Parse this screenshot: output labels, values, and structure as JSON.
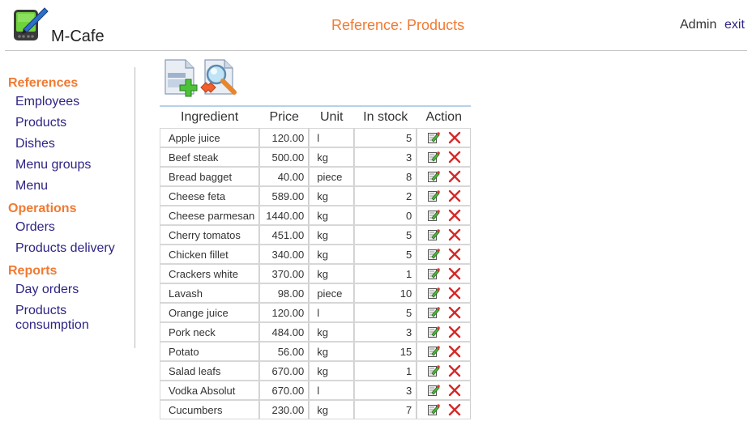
{
  "header": {
    "app_name": "M-Cafe",
    "page_title": "Reference: Products",
    "user_name": "Admin",
    "exit_label": "exit",
    "logo_icon": "pda-stylus-icon"
  },
  "colors": {
    "accent_orange": "#f07a32",
    "link_navy": "#2e2485",
    "delete_red": "#d42a2a"
  },
  "sidebar": {
    "sections": [
      {
        "title": "References",
        "items": [
          {
            "label": "Employees"
          },
          {
            "label": "Products"
          },
          {
            "label": "Dishes"
          },
          {
            "label": "Menu groups"
          },
          {
            "label": "Menu"
          }
        ]
      },
      {
        "title": "Operations",
        "items": [
          {
            "label": "Orders"
          },
          {
            "label": "Products delivery"
          }
        ]
      },
      {
        "title": "Reports",
        "items": [
          {
            "label": "Day orders"
          },
          {
            "label": "Products consumption"
          }
        ]
      }
    ]
  },
  "toolbar": {
    "add_icon": "add-document-icon",
    "search_icon": "find-document-icon"
  },
  "table": {
    "columns": [
      "Ingredient",
      "Price",
      "Unit",
      "In stock",
      "Action"
    ],
    "rows": [
      {
        "name": "Apple juice",
        "price": "120.00",
        "unit": "l",
        "stock": "5"
      },
      {
        "name": "Beef steak",
        "price": "500.00",
        "unit": "kg",
        "stock": "3"
      },
      {
        "name": "Bread bagget",
        "price": "40.00",
        "unit": "piece",
        "stock": "8"
      },
      {
        "name": "Cheese feta",
        "price": "589.00",
        "unit": "kg",
        "stock": "2"
      },
      {
        "name": "Cheese parmesan",
        "price": "1440.00",
        "unit": "kg",
        "stock": "0"
      },
      {
        "name": "Cherry tomatos",
        "price": "451.00",
        "unit": "kg",
        "stock": "5"
      },
      {
        "name": "Chicken fillet",
        "price": "340.00",
        "unit": "kg",
        "stock": "5"
      },
      {
        "name": "Crackers white",
        "price": "370.00",
        "unit": "kg",
        "stock": "1"
      },
      {
        "name": "Lavash",
        "price": "98.00",
        "unit": "piece",
        "stock": "10"
      },
      {
        "name": "Orange juice",
        "price": "120.00",
        "unit": "l",
        "stock": "5"
      },
      {
        "name": "Pork neck",
        "price": "484.00",
        "unit": "kg",
        "stock": "3"
      },
      {
        "name": "Potato",
        "price": "56.00",
        "unit": "kg",
        "stock": "15"
      },
      {
        "name": "Salad leafs",
        "price": "670.00",
        "unit": "kg",
        "stock": "1"
      },
      {
        "name": "Vodka Absolut",
        "price": "670.00",
        "unit": "l",
        "stock": "3"
      },
      {
        "name": "Cucumbers",
        "price": "230.00",
        "unit": "kg",
        "stock": "7"
      }
    ],
    "row_actions": [
      "edit-icon",
      "delete-icon"
    ]
  }
}
